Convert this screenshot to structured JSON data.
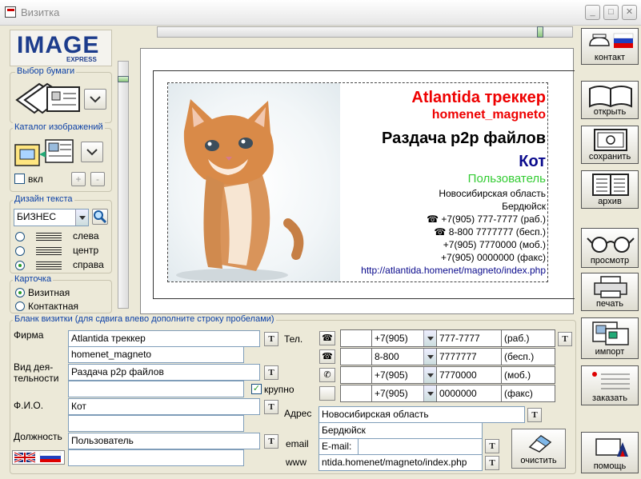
{
  "window": {
    "title": "Визитка",
    "min": "_",
    "max": "□",
    "close": "✕"
  },
  "logo": {
    "image": "IMAGE",
    "express": "EXPRESS"
  },
  "paper": {
    "title": "Выбор бумаги"
  },
  "catalog": {
    "title": "Каталог изображений",
    "enable_label": "вкл",
    "plus": "+",
    "minus": "-"
  },
  "text_design": {
    "title": "Дизайн текста",
    "font": "БИЗНЕС",
    "align": [
      {
        "label": "слева",
        "selected": false
      },
      {
        "label": "центр",
        "selected": false
      },
      {
        "label": "справа",
        "selected": true
      }
    ]
  },
  "card_type": {
    "title": "Карточка",
    "options": [
      {
        "label": "Визитная",
        "selected": true
      },
      {
        "label": "Контактная",
        "selected": false
      }
    ]
  },
  "preview": {
    "company": "Atlantida треккер",
    "company2": "homenet_magneto",
    "activity": "Раздача p2p файлов",
    "name": "Кот",
    "position": "Пользователь",
    "address1": "Новосибирская область",
    "address2": "Бердюйск",
    "phones": [
      {
        "icon": "☎",
        "text": "+7(905) 777-7777 (раб.)"
      },
      {
        "icon": "☎",
        "text": "8-800 7777777 (бесп.)"
      },
      {
        "icon": "",
        "text": "+7(905) 7770000 (моб.)"
      },
      {
        "icon": "",
        "text": "+7(905) 0000000 (факс)"
      }
    ],
    "url": "http://atlantida.homenet/magneto/index.php",
    "colors": {
      "company": "#ee0000",
      "name": "#0a0a8c",
      "position": "#33cc33"
    }
  },
  "form": {
    "title": "Бланк визитки (для сдвига влево дополните строку пробелами)",
    "firm_label": "Фирма",
    "firm1": "Atlantida треккер",
    "firm2": "homenet_magneto",
    "activity_label": "Вид дея-тельности",
    "activity1": "Раздача p2p файлов",
    "activity2": "",
    "bold_label": "крупно",
    "bold_checked": true,
    "fio_label": "Ф.И.О.",
    "fio1": "Кот",
    "fio2": "",
    "position_label": "Должность",
    "position1": "Пользователь",
    "position2": "",
    "tel_label": "Тел.",
    "phones": [
      {
        "code": "+7(905)",
        "number": "777-7777",
        "type": "(раб.)"
      },
      {
        "code": "8-800",
        "number": "7777777",
        "type": "(бесп.)"
      },
      {
        "code": "+7(905)",
        "number": "7770000",
        "type": "(моб.)"
      },
      {
        "code": "+7(905)",
        "number": "0000000",
        "type": "(факс)"
      }
    ],
    "address_label": "Адрес",
    "address1": "Новосибирская область",
    "address2": "Бердюйск",
    "email_label": "email",
    "email_value": "E-mail:",
    "www_label": "www",
    "www_value": "ntida.homenet/magneto/index.php",
    "t_label": "T",
    "clear_label": "очистить"
  },
  "right_buttons": {
    "contact": "контакт",
    "open": "открыть",
    "save": "сохранить",
    "archive": "архив",
    "preview": "просмотр",
    "print": "печать",
    "import": "импорт",
    "order": "заказать",
    "help": "помощь"
  }
}
